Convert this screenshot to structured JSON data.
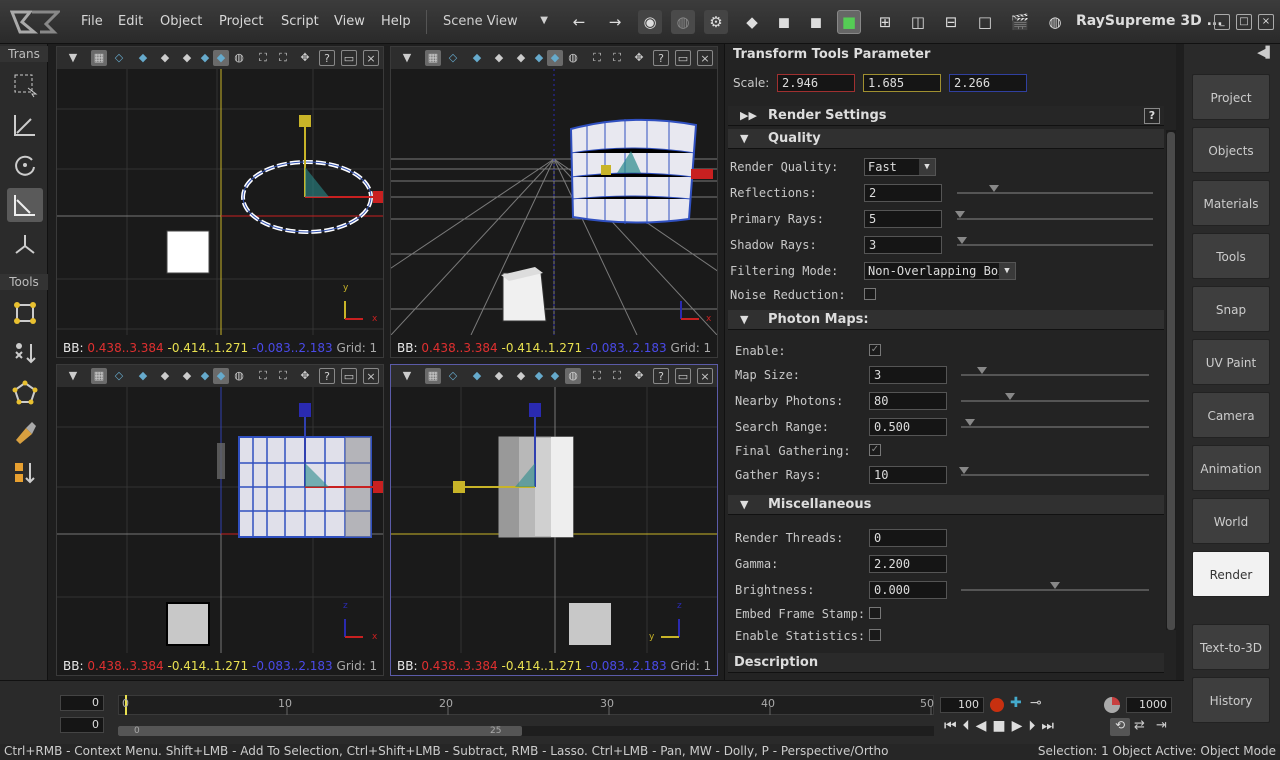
{
  "app": {
    "title": "RaySupreme 3D ...",
    "menu": [
      "File",
      "Edit",
      "Object",
      "Project",
      "Script",
      "View",
      "Help"
    ],
    "view_mode": "Scene View"
  },
  "left_toolbar": {
    "trans_label": "Trans",
    "tools_label": "Tools"
  },
  "viewports": [
    {
      "bb_label": "BB:",
      "bb_x": "0.438..3.384",
      "bb_y": "-0.414..1.271",
      "bb_z": "-0.083..2.183",
      "grid": "Grid: 1",
      "axis_v": "y",
      "axis_h": "x"
    },
    {
      "bb_label": "BB:",
      "bb_x": "0.438..3.384",
      "bb_y": "-0.414..1.271",
      "bb_z": "-0.083..2.183",
      "grid": "Grid: 1",
      "axis_v": "",
      "axis_h": "x"
    },
    {
      "bb_label": "BB:",
      "bb_x": "0.438..3.384",
      "bb_y": "-0.414..1.271",
      "bb_z": "-0.083..2.183",
      "grid": "Grid: 1",
      "axis_v": "z",
      "axis_h": "x"
    },
    {
      "bb_label": "BB:",
      "bb_x": "0.438..3.384",
      "bb_y": "-0.414..1.271",
      "bb_z": "-0.083..2.183",
      "grid": "Grid: 1",
      "axis_v": "z",
      "axis_h": "y"
    }
  ],
  "panel": {
    "title": "Transform Tools Parameter",
    "scale_label": "Scale:",
    "scale": [
      "2.946",
      "1.685",
      "2.266"
    ],
    "render_settings": "Render Settings",
    "quality": {
      "header": "Quality",
      "render_quality_label": "Render Quality:",
      "render_quality": "Fast",
      "reflections_label": "Reflections:",
      "reflections": "2",
      "primary_rays_label": "Primary Rays:",
      "primary_rays": "5",
      "shadow_rays_label": "Shadow Rays:",
      "shadow_rays": "3",
      "filtering_label": "Filtering Mode:",
      "filtering": "Non-Overlapping Box",
      "noise_label": "Noise Reduction:",
      "noise_checked": false
    },
    "photon": {
      "header": "Photon Maps:",
      "enable_label": "Enable:",
      "enable_checked": true,
      "map_size_label": "Map Size:",
      "map_size": "3",
      "nearby_label": "Nearby Photons:",
      "nearby": "80",
      "search_label": "Search Range:",
      "search": "0.500",
      "final_label": "Final Gathering:",
      "final_checked": true,
      "gather_label": "Gather Rays:",
      "gather": "10"
    },
    "misc": {
      "header": "Miscellaneous",
      "threads_label": "Render Threads:",
      "threads": "0",
      "gamma_label": "Gamma:",
      "gamma": "2.200",
      "brightness_label": "Brightness:",
      "brightness": "0.000",
      "stamp_label": "Embed Frame Stamp:",
      "stamp_checked": false,
      "stats_label": "Enable Statistics:",
      "stats_checked": false
    },
    "description": "Description"
  },
  "right_tabs": [
    "Project",
    "Objects",
    "Materials",
    "Tools",
    "Snap",
    "UV Paint",
    "Camera",
    "Animation",
    "World",
    "Render",
    "Text-to-3D",
    "History"
  ],
  "active_tab": "Render",
  "timeline": {
    "start_field": "0",
    "current_field": "0",
    "ticks": [
      "0",
      "10",
      "20",
      "30",
      "40",
      "50"
    ],
    "scroll_start": "0",
    "scroll_mid": "25",
    "end_frame": "100",
    "total_frames": "1000"
  },
  "status": {
    "hint": "Ctrl+RMB - Context Menu. Shift+LMB - Add To Selection, Ctrl+Shift+LMB - Subtract, RMB - Lasso. Ctrl+LMB - Pan, MW - Dolly, P - Perspective/Ortho",
    "selection": "Selection: 1 Object  Active: Object Mode"
  }
}
